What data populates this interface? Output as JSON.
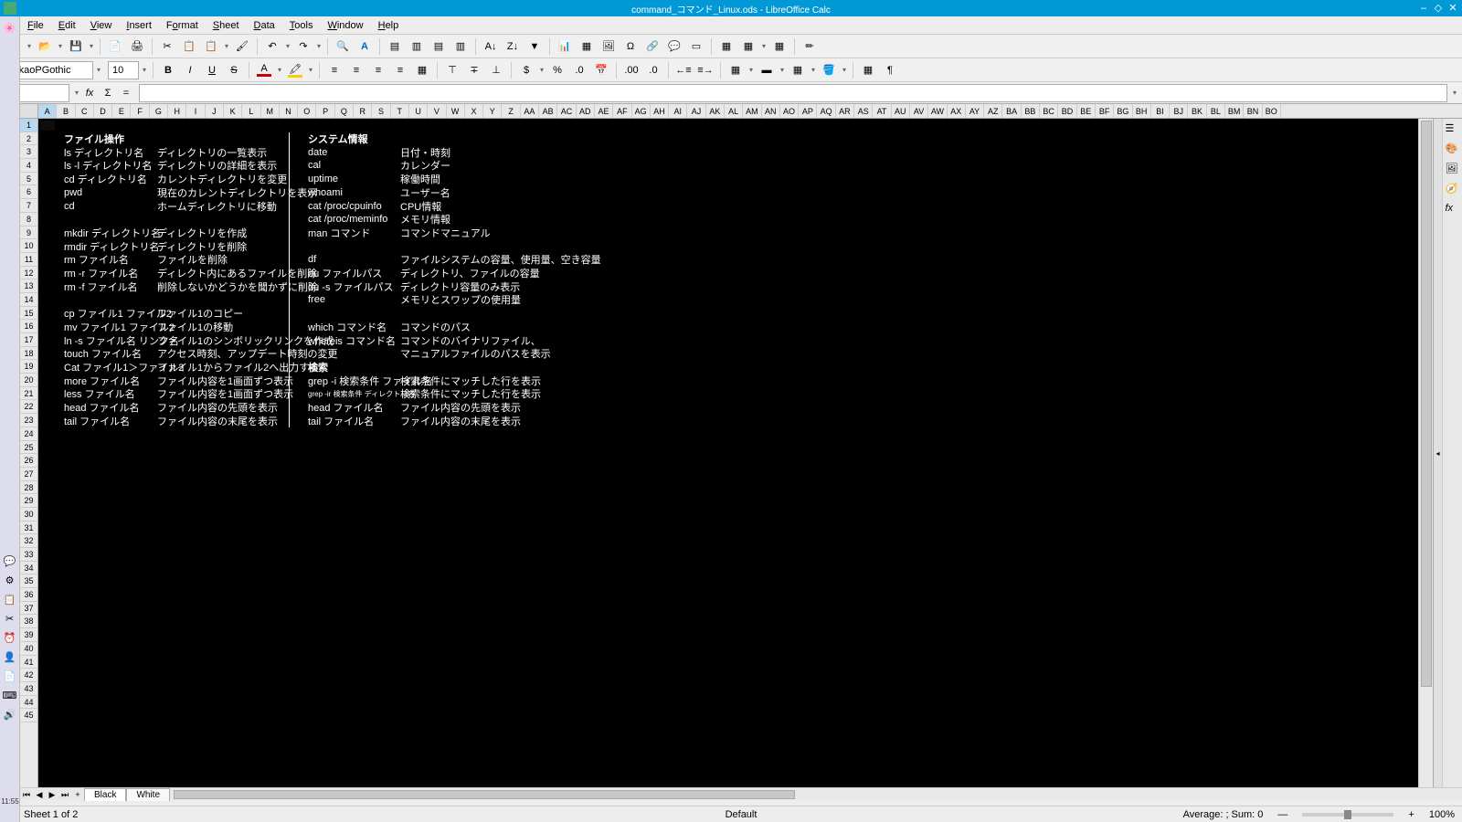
{
  "window": {
    "title": "command_コマンド_Linux.ods - LibreOffice Calc",
    "time": "11:55"
  },
  "menu": {
    "file": "File",
    "edit": "Edit",
    "view": "View",
    "insert": "Insert",
    "format": "Format",
    "sheet": "Sheet",
    "data": "Data",
    "tools": "Tools",
    "window": "Window",
    "help": "Help"
  },
  "formatting": {
    "font_name": "TakaoPGothic",
    "font_size": "10"
  },
  "cell_ref": "A1",
  "sheets": {
    "tab1": "Black",
    "tab2": "White"
  },
  "status": {
    "sheet": "Sheet 1 of 2",
    "style": "Default",
    "summary": "Average: ; Sum: 0",
    "zoom": "100%"
  },
  "columns": [
    "A",
    "B",
    "C",
    "D",
    "E",
    "F",
    "G",
    "H",
    "I",
    "J",
    "K",
    "L",
    "M",
    "N",
    "O",
    "P",
    "Q",
    "R",
    "S",
    "T",
    "U",
    "V",
    "W",
    "X",
    "Y",
    "Z",
    "AA",
    "AB",
    "AC",
    "AD",
    "AE",
    "AF",
    "AG",
    "AH",
    "AI",
    "AJ",
    "AK",
    "AL",
    "AM",
    "AN",
    "AO",
    "AP",
    "AQ",
    "AR",
    "AS",
    "AT",
    "AU",
    "AV",
    "AW",
    "AX",
    "AY",
    "AZ",
    "BA",
    "BB",
    "BC",
    "BD",
    "BE",
    "BF",
    "BG",
    "BH",
    "BI",
    "BJ",
    "BK",
    "BL",
    "BM",
    "BN",
    "BO"
  ],
  "rows": [
    "1",
    "2",
    "3",
    "4",
    "5",
    "6",
    "7",
    "8",
    "9",
    "10",
    "11",
    "12",
    "13",
    "14",
    "15",
    "16",
    "17",
    "18",
    "19",
    "20",
    "21",
    "22",
    "23",
    "24",
    "25",
    "26",
    "27",
    "28",
    "29",
    "30",
    "31",
    "32",
    "33",
    "34",
    "35",
    "36",
    "37",
    "38",
    "39",
    "40",
    "41",
    "42",
    "43",
    "44",
    "45"
  ],
  "content": [
    {
      "r": 2,
      "c1": "ファイル操作",
      "h": true,
      "c3": "システム情報",
      "h3": true
    },
    {
      "r": 3,
      "c1": "ls ディレクトリ名",
      "c2": "ディレクトリの一覧表示",
      "c3": "date",
      "c4": "日付・時刻"
    },
    {
      "r": 4,
      "c1": "ls -l ディレクトリ名",
      "c2": "ディレクトリの詳細を表示",
      "c3": "cal",
      "c4": "カレンダー"
    },
    {
      "r": 5,
      "c1": "cd ディレクトリ名",
      "c2": "カレントディレクトリを変更",
      "c3": "uptime",
      "c4": "稼働時間"
    },
    {
      "r": 6,
      "c1": "pwd",
      "c2": "現在のカレントディレクトリを表示",
      "c3": "whoami",
      "c4": "ユーザー名"
    },
    {
      "r": 7,
      "c1": "cd",
      "c2": "ホームディレクトリに移動",
      "c3": "cat /proc/cpuinfo",
      "c4": "CPU情報"
    },
    {
      "r": 8,
      "c3": "cat /proc/meminfo",
      "c4": "メモリ情報"
    },
    {
      "r": 9,
      "c1": "mkdir ディレクトリ名",
      "c2": "ディレクトリを作成",
      "c3": "man コマンド",
      "c4": "コマンドマニュアル"
    },
    {
      "r": 10,
      "c1": "rmdir ディレクトリ名",
      "c2": "ディレクトリを削除"
    },
    {
      "r": 11,
      "c1": "rm ファイル名",
      "c2": "ファイルを削除",
      "c3": "df",
      "c4": "ファイルシステムの容量、使用量、空き容量"
    },
    {
      "r": 12,
      "c1": "rm -r ファイル名",
      "c2": "ディレクト内にあるファイルを削除",
      "c3": "du ファイルパス",
      "c4": "ディレクトリ、ファイルの容量"
    },
    {
      "r": 13,
      "c1": "rm -f ファイル名",
      "c2": "削除しないかどうかを聞かずに削除",
      "c3": "du -s ファイルパス",
      "c4": "ディレクトリ容量のみ表示"
    },
    {
      "r": 14,
      "c3": "free",
      "c4": "メモリとスワップの使用量"
    },
    {
      "r": 15,
      "c1": "cp ファイル1 ファイル2",
      "c2": "ファイル1のコピー"
    },
    {
      "r": 16,
      "c1": "mv ファイル1 ファイル2",
      "c2": "ファイル1の移動",
      "c3": "which コマンド名",
      "c4": "コマンドのパス"
    },
    {
      "r": 17,
      "c1": "ln -s ファイル名 リンク名",
      "c2": "ファイル1のシンボリックリンクを作成",
      "c3": "whereis コマンド名",
      "c4": "コマンドのバイナリファイル、"
    },
    {
      "r": 18,
      "c1": "touch ファイル名",
      "c2": "アクセス時刻、アップデート時刻の変更",
      "c4": "マニュアルファイルのパスを表示"
    },
    {
      "r": 19,
      "c1": "Cat ファイル1＞ファイル2",
      "c2": "ファイル1からファイル2へ出力する",
      "c3": "検索",
      "h3": true
    },
    {
      "r": 20,
      "c1": "more ファイル名",
      "c2": "ファイル内容を1画面ずつ表示",
      "c3": "grep -i 検索条件 ファイル名",
      "c4": "検索条件にマッチした行を表示"
    },
    {
      "r": 21,
      "c1": "less ファイル名",
      "c2": "ファイル内容を1画面ずつ表示",
      "c3": "grep -ir 検索条件 ディレクトリ名",
      "c4": "検索条件にマッチした行を表示",
      "small3": true
    },
    {
      "r": 22,
      "c1": "head ファイル名",
      "c2": "ファイル内容の先頭を表示",
      "c3": "head ファイル名",
      "c4": "ファイル内容の先頭を表示"
    },
    {
      "r": 23,
      "c1": "tail ファイル名",
      "c2": "ファイル内容の末尾を表示",
      "c3": "tail ファイル名",
      "c4": "ファイル内容の末尾を表示"
    }
  ]
}
